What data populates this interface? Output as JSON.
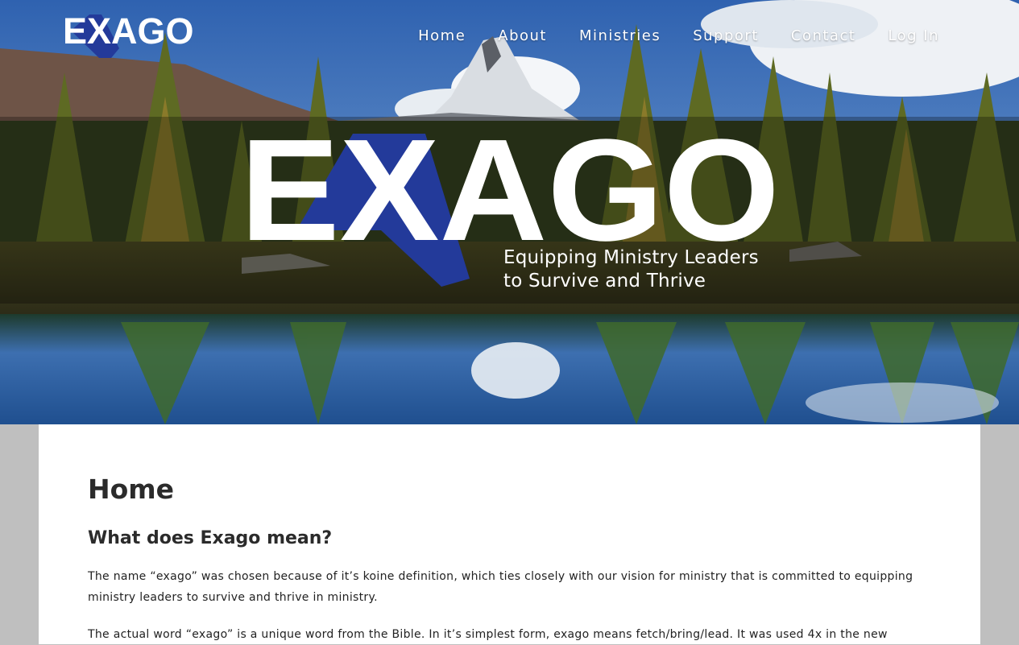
{
  "brand": {
    "name": "EXAGO",
    "x_color": "#233a9a",
    "text_color": "#ffffff"
  },
  "nav": {
    "items": [
      {
        "label": "Home",
        "id": "home"
      },
      {
        "label": "About",
        "id": "about"
      },
      {
        "label": "Ministries",
        "id": "ministries"
      },
      {
        "label": "Support",
        "id": "support"
      },
      {
        "label": "Contact",
        "id": "contact"
      },
      {
        "label": "Log In",
        "id": "login"
      }
    ]
  },
  "hero": {
    "tagline_line1": "Equipping Ministry Leaders",
    "tagline_line2": "to Survive and Thrive"
  },
  "content": {
    "title": "Home",
    "subtitle": "What does Exago mean?",
    "paragraph1": "The name “exago” was chosen because of it’s koine definition, which ties closely with our vision for ministry that is committed to equipping ministry leaders to survive and thrive in ministry.",
    "paragraph2": "The actual word “exago” is a unique word from the Bible. In it’s simplest form, exago means fetch/bring/lead. It was used 4x in the new"
  }
}
